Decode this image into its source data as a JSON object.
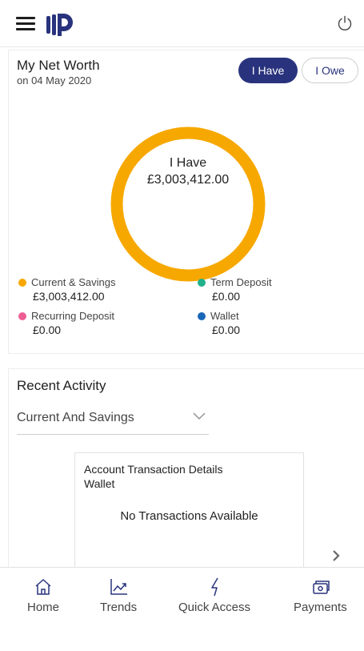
{
  "header": {
    "menu_icon": "hamburger-menu-icon",
    "logo_icon": "bank-logo-icon",
    "power_icon": "power-icon"
  },
  "net_worth": {
    "title": "My Net Worth",
    "date": "on 04 May 2020",
    "toggle_have": "I Have",
    "toggle_owe": "I Owe",
    "center_label": "I Have",
    "center_amount": "£3,003,412.00",
    "ring_color": "#f7a800",
    "legend": [
      {
        "name": "Current & Savings",
        "value": "£3,003,412.00",
        "color": "#f7a800"
      },
      {
        "name": "Term Deposit",
        "value": "£0.00",
        "color": "#21b18b"
      },
      {
        "name": "Recurring Deposit",
        "value": "£0.00",
        "color": "#ee5d93"
      },
      {
        "name": "Wallet",
        "value": "£0.00",
        "color": "#1a66b7"
      }
    ]
  },
  "recent_activity": {
    "title": "Recent Activity",
    "account_selected": "Current And Savings",
    "card": {
      "title": "Account Transaction Details",
      "subtitle": "Wallet",
      "empty_message": "No Transactions Available"
    }
  },
  "bottom_nav": {
    "items": [
      {
        "label": "Home",
        "icon": "home-icon"
      },
      {
        "label": "Trends",
        "icon": "trends-icon"
      },
      {
        "label": "Quick Access",
        "icon": "lightning-icon"
      },
      {
        "label": "Payments",
        "icon": "payments-icon"
      }
    ],
    "accent": "#29337d"
  }
}
